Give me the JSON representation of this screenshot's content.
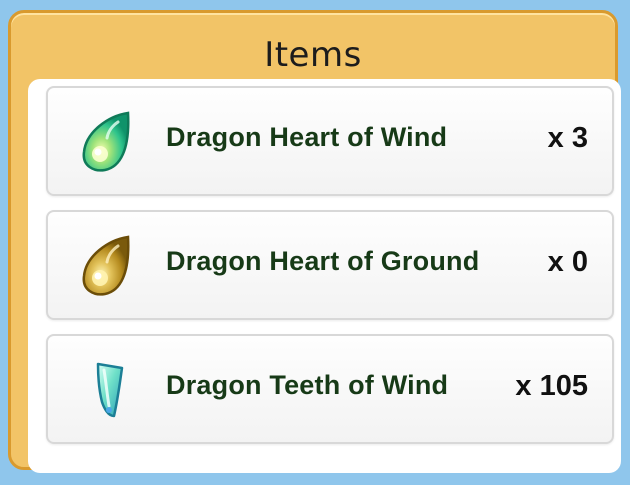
{
  "panel": {
    "title": "Items"
  },
  "items": [
    {
      "name": "Dragon Heart of Wind",
      "quantity": "x 3",
      "icon": "dragon-heart-wind-icon",
      "color": "#2fc48c"
    },
    {
      "name": "Dragon Heart of Ground",
      "quantity": "x 0",
      "icon": "dragon-heart-ground-icon",
      "color": "#b48a1e"
    },
    {
      "name": "Dragon Teeth of Wind",
      "quantity": "x 105",
      "icon": "dragon-teeth-wind-icon",
      "color": "#3ec9b4"
    }
  ]
}
